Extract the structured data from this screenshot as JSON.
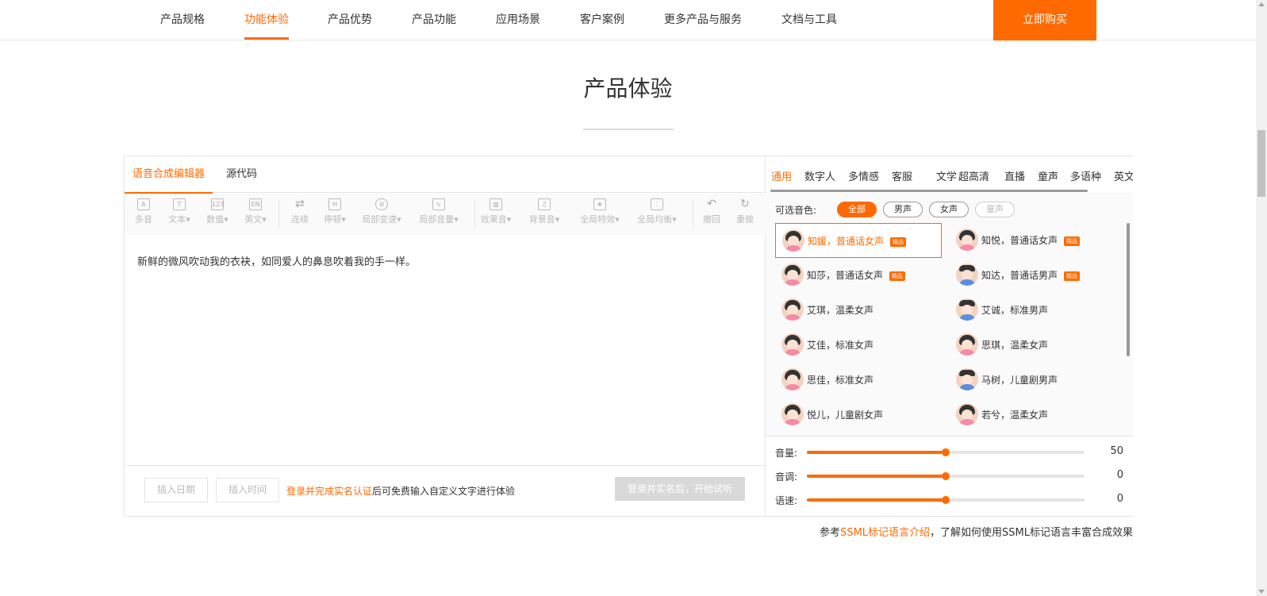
{
  "nav": {
    "items": [
      {
        "label": "产品规格",
        "active": false
      },
      {
        "label": "功能体验",
        "active": true
      },
      {
        "label": "产品优势",
        "active": false
      },
      {
        "label": "产品功能",
        "active": false
      },
      {
        "label": "应用场景",
        "active": false
      },
      {
        "label": "客户案例",
        "active": false
      },
      {
        "label": "更多产品与服务",
        "active": false
      },
      {
        "label": "文档与工具",
        "active": false
      }
    ],
    "buy_label": "立即购买"
  },
  "page_title": "产品体验",
  "editor": {
    "tabs": [
      "语音合成编辑器",
      "源代码"
    ],
    "toolbar": [
      {
        "label": "多音",
        "icon": "A"
      },
      {
        "label": "文本▾",
        "icon": "T"
      },
      {
        "label": "数值▾",
        "icon": "123"
      },
      {
        "label": "英文▾",
        "icon": "EN"
      },
      {
        "label": "连续",
        "icon": "⇄"
      },
      {
        "label": "停顿▾",
        "icon": "H"
      },
      {
        "label": "局部变速▾",
        "icon": "⊘"
      },
      {
        "label": "局部音量▾",
        "icon": "∿"
      },
      {
        "label": "效果音▾",
        "icon": "▥"
      },
      {
        "label": "背景音▾",
        "icon": "♫"
      },
      {
        "label": "全局特效▾",
        "icon": "★"
      },
      {
        "label": "全局均衡▾",
        "icon": "⫶"
      },
      {
        "label": "撤回",
        "icon": "↶"
      },
      {
        "label": "重做",
        "icon": "↻"
      }
    ],
    "text": "新鲜的微风吹动我的衣袂，如同爱人的鼻息吹着我的手一样。",
    "insert_date": "插入日期",
    "insert_time": "插入时间",
    "hint_link": "登录并完成实名认证",
    "hint_text": "后可免费输入自定义文字进行体验",
    "start_button": "登录并实名后，开始试听"
  },
  "voices_panel": {
    "categories": [
      "通用",
      "数字人",
      "多情感",
      "客服",
      "文学",
      "超高清",
      "直播",
      "童声",
      "多语种",
      "英文"
    ],
    "filter_label": "可选音色:",
    "filters": [
      {
        "label": "全部",
        "state": "active"
      },
      {
        "label": "男声",
        "state": "normal"
      },
      {
        "label": "女声",
        "state": "normal"
      },
      {
        "label": "童声",
        "state": "disabled"
      }
    ],
    "voices": [
      {
        "name": "知媛，普通话女声",
        "badge": "精品",
        "gender": "female",
        "selected": true
      },
      {
        "name": "知悦，普通话女声",
        "badge": "精品",
        "gender": "female",
        "selected": false
      },
      {
        "name": "知莎，普通话女声",
        "badge": "精品",
        "gender": "female",
        "selected": false
      },
      {
        "name": "知达，普通话男声",
        "badge": "精品",
        "gender": "male",
        "selected": false
      },
      {
        "name": "艾琪，温柔女声",
        "badge": "",
        "gender": "female",
        "selected": false
      },
      {
        "name": "艾诚，标准男声",
        "badge": "",
        "gender": "male",
        "selected": false
      },
      {
        "name": "艾佳，标准女声",
        "badge": "",
        "gender": "female",
        "selected": false
      },
      {
        "name": "思琪，温柔女声",
        "badge": "",
        "gender": "female",
        "selected": false
      },
      {
        "name": "思佳，标准女声",
        "badge": "",
        "gender": "female",
        "selected": false
      },
      {
        "name": "马树，儿童剧男声",
        "badge": "",
        "gender": "male",
        "selected": false
      },
      {
        "name": "悦儿，儿童剧女声",
        "badge": "",
        "gender": "female",
        "selected": false
      },
      {
        "name": "若兮，温柔女声",
        "badge": "",
        "gender": "female",
        "selected": false
      }
    ],
    "sliders": [
      {
        "label": "音量:",
        "value": "50",
        "fill": 0.5
      },
      {
        "label": "音调:",
        "value": "0",
        "fill": 0.5
      },
      {
        "label": "语速:",
        "value": "0",
        "fill": 0.5
      }
    ]
  },
  "footnote": {
    "prefix": "参考",
    "link": "SSML标记语言介绍",
    "suffix": "，了解如何使用SSML标记语言丰富合成效果"
  },
  "colors": {
    "accent": "#ff6a00",
    "disabled_button": "#d9d9d9"
  }
}
